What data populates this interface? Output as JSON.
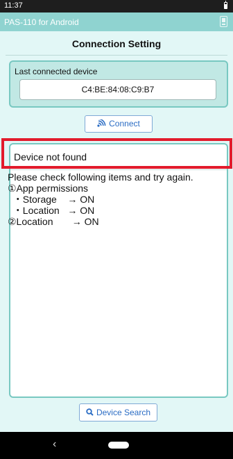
{
  "status_bar": {
    "time": "11:37"
  },
  "app_bar": {
    "title": "PAS-110 for Android"
  },
  "screen": {
    "title": "Connection Setting"
  },
  "last_connected": {
    "label": "Last connected device",
    "address": "C4:BE:84:08:C9:B7"
  },
  "connect_button": {
    "label": "Connect",
    "icon": "wireless-icon"
  },
  "message": {
    "title": "Device not found",
    "lines": [
      "Please check following items and try again.",
      "①App permissions",
      "  ・Storage    → ON",
      "  ・Location   → ON",
      "②Location       → ON"
    ]
  },
  "search_button": {
    "label": "Device Search",
    "icon": "search-icon"
  },
  "nav_bar": {
    "back_icon": "back-icon",
    "home_icon": "home-icon"
  },
  "colors": {
    "app_bar": "#8fd3d0",
    "background": "#e2f7f6",
    "panel_border": "#78c8c1",
    "button_text": "#2a6cc4",
    "highlight": "#e21b2c"
  }
}
